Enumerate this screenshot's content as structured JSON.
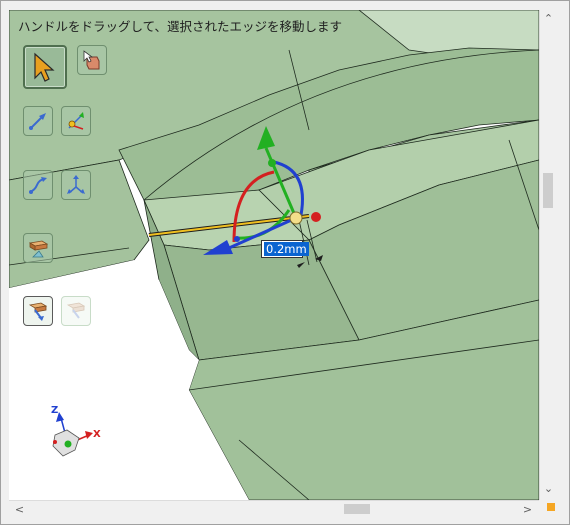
{
  "hint_text": "ハンドルをドラッグして、選択されたエッジを移動します",
  "dimension": {
    "value": "0.2mm"
  },
  "triad": {
    "z_label": "Z",
    "x_label": "X"
  },
  "tools": [
    {
      "name": "select-tool",
      "icon": "cursor-arrow-icon",
      "state": "active"
    },
    {
      "name": "select-filter-tool",
      "icon": "cursor-box-icon",
      "state": "normal"
    },
    {
      "name": "line-tool",
      "icon": "line-arrow-icon",
      "state": "normal"
    },
    {
      "name": "point-line-tool",
      "icon": "point-line-icon",
      "state": "normal"
    },
    {
      "name": "curve-tool",
      "icon": "curve-arrow-icon",
      "state": "normal"
    },
    {
      "name": "axes-tool",
      "icon": "three-axes-icon",
      "state": "normal"
    },
    {
      "name": "pull-tool",
      "icon": "block-pull-icon",
      "state": "normal"
    },
    {
      "name": "move-tool",
      "icon": "block-move-icon",
      "state": "selected"
    },
    {
      "name": "disabled-tool",
      "icon": "block-move-faded-icon",
      "state": "disabled"
    }
  ],
  "colors": {
    "model_face": "#a4c29d",
    "model_face_dark": "#8fb08a",
    "model_face_light": "#b6d1ae",
    "edge": "#1e2a1e",
    "axis_x": "#d42020",
    "axis_y": "#22b022",
    "axis_z": "#2040d0",
    "selected_edge": "#f0c020",
    "dimension_highlight": "#0a64d0",
    "scroll_thumb": "#cdcdcd",
    "size_grip": "#f5a623"
  },
  "scrollbars": {
    "vertical": {
      "up_icon": "chevron-up-icon",
      "down_icon": "chevron-down-icon",
      "thumb_position": 0.37
    },
    "horizontal": {
      "left_icon": "chevron-left-icon",
      "right_icon": "chevron-right-icon",
      "thumb_position": 0.66
    }
  }
}
